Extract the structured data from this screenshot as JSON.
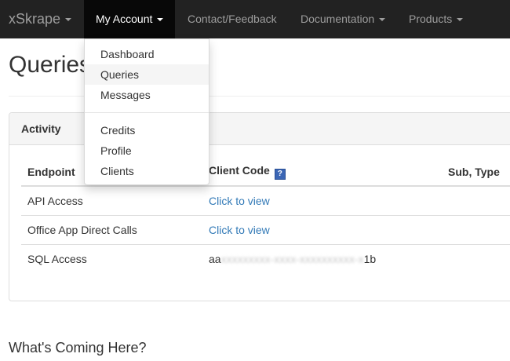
{
  "navbar": {
    "brand": "xSkrape",
    "items": [
      {
        "label": "My Account"
      },
      {
        "label": "Contact/Feedback"
      },
      {
        "label": "Documentation"
      },
      {
        "label": "Products"
      }
    ]
  },
  "dropdown": {
    "group1": [
      "Dashboard",
      "Queries",
      "Messages"
    ],
    "group2": [
      "Credits",
      "Profile",
      "Clients"
    ]
  },
  "page": {
    "title": "Queries",
    "section_title": "What's Coming Here?"
  },
  "panel": {
    "heading": "Activity",
    "columns": [
      "Endpoint",
      "Client Code",
      "Sub, Type"
    ],
    "help_icon_glyph": "?",
    "rows": [
      {
        "endpoint": "API Access",
        "client_code": "Click to view"
      },
      {
        "endpoint": "Office App Direct Calls",
        "client_code": "Click to view"
      },
      {
        "endpoint": "SQL Access",
        "code_start": "aa",
        "code_masked": "xxxxxxxxx-xxxx-xxxxxxxxxx-x",
        "code_end": "1b"
      }
    ]
  },
  "colors": {
    "navbar_bg": "#222222",
    "navbar_active_bg": "#080808",
    "link": "#337ab7",
    "help_icon": "#3b66b5"
  }
}
